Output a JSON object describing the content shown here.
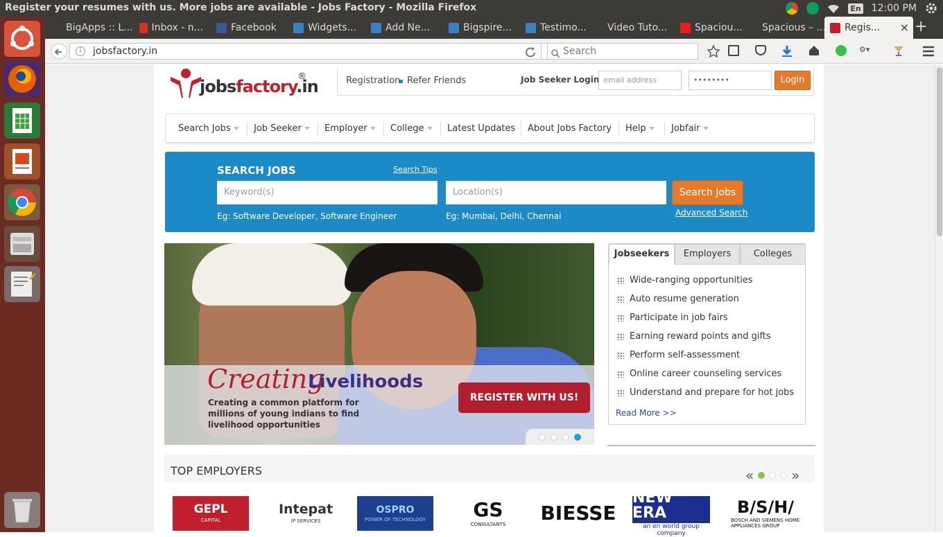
{
  "window": {
    "title": "Register your resumes with us. More jobs are available - Jobs Factory - Mozilla Firefox"
  },
  "tray": {
    "language": "En",
    "time": "12:00 PM"
  },
  "browser": {
    "tabs": [
      {
        "label": "BigApps :: L...",
        "icon": "bigapps-icon"
      },
      {
        "label": "Inbox - n...",
        "icon": "gmail-icon"
      },
      {
        "label": "Facebook",
        "icon": "facebook-icon"
      },
      {
        "label": "Widgets...",
        "icon": "blogger-icon"
      },
      {
        "label": "Add Ne...",
        "icon": "blogger-icon"
      },
      {
        "label": "Bigspire...",
        "icon": "blogger-icon"
      },
      {
        "label": "Testimo...",
        "icon": "blogger-icon"
      },
      {
        "label": "Video Tuto...",
        "icon": "page-icon"
      },
      {
        "label": "Spaciou...",
        "icon": "youtube-icon"
      },
      {
        "label": "Spacious – ...",
        "icon": "page-icon"
      },
      {
        "label": "Regis...",
        "icon": "jobsfactory-icon"
      }
    ],
    "url": "jobsfactory.in",
    "search_placeholder": "Search"
  },
  "site": {
    "logo": {
      "text_plain": "jobs",
      "text_accent": "factory",
      "domain": ".in",
      "reg": "®"
    },
    "toplinks": {
      "registration": "Registration",
      "refer": "Refer Friends",
      "login_label": "Job Seeker Login",
      "email_placeholder": "email address",
      "password_value": "••••••••",
      "login_button": "Login"
    },
    "nav": [
      {
        "label": "Search Jobs",
        "dropdown": true
      },
      {
        "label": "Job Seeker",
        "dropdown": true
      },
      {
        "label": "Employer",
        "dropdown": true
      },
      {
        "label": "College",
        "dropdown": true
      },
      {
        "label": "Latest Updates",
        "dropdown": false
      },
      {
        "label": "About Jobs Factory",
        "dropdown": false
      },
      {
        "label": "Help",
        "dropdown": true
      },
      {
        "label": "Jobfair",
        "dropdown": true
      }
    ],
    "search": {
      "heading": "SEARCH JOBS",
      "tips": "Search Tips",
      "keyword_placeholder": "Keyword(s)",
      "location_placeholder": "Location(s)",
      "button": "Search Jobs",
      "advanced": "Advanced Search",
      "keyword_example": "Eg: Software Developer, Software Engineer",
      "location_example": "Eg: Mumbai, Delhi, Chennai"
    },
    "hero": {
      "creating": "Creating",
      "livelihoods": "Livelihoods",
      "subtitle": "Creating a common platform for millions of young indians to find livelihood opportunities",
      "register_button": "REGISTER WITH US!",
      "slides": 4,
      "active_slide": 4
    },
    "panel": {
      "tabs": [
        "Jobseekers",
        "Employers",
        "Colleges"
      ],
      "items": [
        "Wide-ranging opportunities",
        "Auto resume generation",
        "Participate in job fairs",
        "Earning reward points and gifts",
        "Perform self-assessment",
        "Online career counseling services",
        "Understand and prepare for hot jobs"
      ],
      "read_more": "Read More >>"
    },
    "employers": {
      "heading": "TOP EMPLOYERS",
      "prev": "«",
      "next": "»",
      "logos": [
        {
          "name": "GEPL CAPITAL",
          "line1": "GEPL",
          "line2": "CAPITAL"
        },
        {
          "name": "Intepat",
          "line1": "Intepat",
          "line2": "IP SERVICES"
        },
        {
          "name": "OSPRO",
          "line1": "OSPRO",
          "line2": "POWER OF TECHNOLOGY"
        },
        {
          "name": "GS",
          "line1": "GS",
          "line2": "CONSULTANTS"
        },
        {
          "name": "BIESSE",
          "line1": "BIESSE",
          "line2": ""
        },
        {
          "name": "NEW ERA",
          "line1": "NEW ERA",
          "line2": "an en world group company"
        },
        {
          "name": "B/S/H/",
          "line1": "B/S/H/",
          "line2": "BOSCH AND SIEMENS HOME APPLIANCES GROUP"
        }
      ]
    }
  },
  "colors": {
    "accent_orange": "#e57b2a",
    "search_blue": "#1b8ac7",
    "brand_red": "#c41e2b",
    "hero_red": "#b11f2e"
  }
}
